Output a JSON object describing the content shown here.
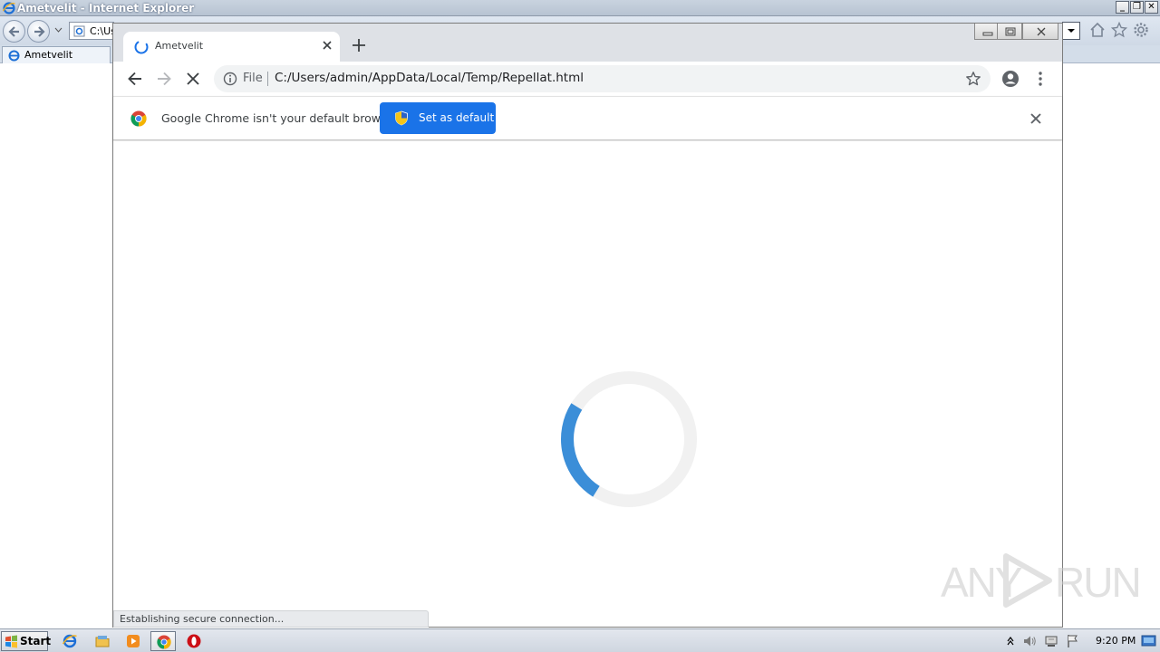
{
  "ie": {
    "window_title": "Ametvelit - Internet Explorer",
    "address_text": "C:\\Us",
    "tab_label": "Ametvelit"
  },
  "chrome": {
    "tab_title": "Ametvelit",
    "omnibox": {
      "scheme_label": "File",
      "url": "C:/Users/admin/AppData/Local/Temp/Repellat.html"
    },
    "infobar": {
      "message": "Google Chrome isn't your default browser",
      "button_label": "Set as default"
    },
    "status_text": "Establishing secure connection...",
    "loader_progress": 0.25
  },
  "watermark": {
    "left": "ANY",
    "right": "RUN"
  },
  "taskbar": {
    "start_label": "Start",
    "apps": [
      "internet-explorer",
      "file-explorer",
      "media-player",
      "chrome",
      "opera"
    ],
    "clock": "9:20 PM"
  },
  "colors": {
    "chrome_accent": "#1a73e8",
    "loader_arc": "#3b8ed8",
    "loader_track": "#f1f1f1",
    "tabstrip": "#dee1e6"
  }
}
